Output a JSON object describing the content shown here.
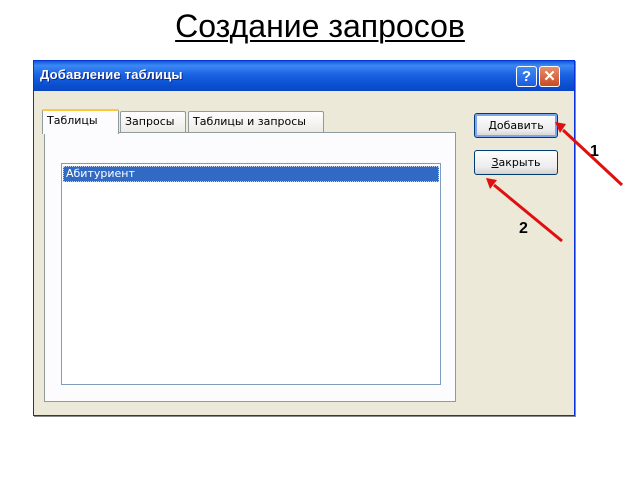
{
  "slide": {
    "title": "Создание запросов"
  },
  "dialog": {
    "title": "Добавление таблицы",
    "help_glyph": "?",
    "close_glyph": "✕",
    "tabs": [
      {
        "label": "Таблицы",
        "active": true
      },
      {
        "label": "Запросы",
        "active": false
      },
      {
        "label": "Таблицы и запросы",
        "active": false
      }
    ],
    "list_items": [
      "Абитуриент"
    ],
    "buttons": {
      "add": {
        "label": "Добавить",
        "mnemonic": "Д",
        "rest": "обавить"
      },
      "close": {
        "label": "Закрыть",
        "mnemonic": "З",
        "rest": "акрыть"
      }
    }
  },
  "callouts": {
    "one": "1",
    "two": "2"
  },
  "colors": {
    "titlebar": "#0a5bd6",
    "selection": "#316ac5",
    "arrow": "#e01010",
    "active_tab_accent": "#ffc83c"
  }
}
